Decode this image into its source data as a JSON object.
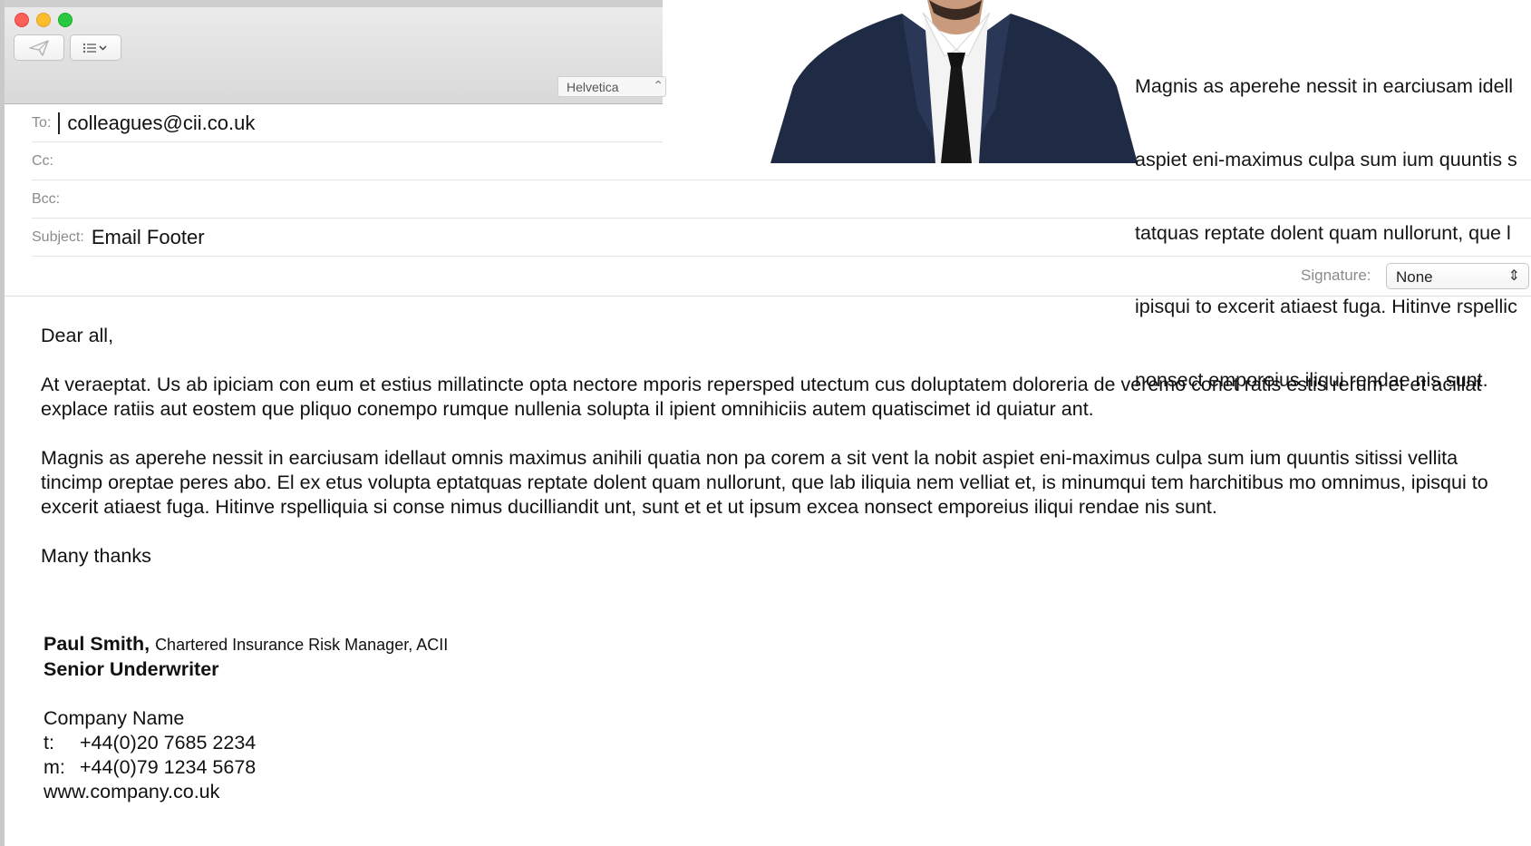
{
  "background_doc": {
    "paragraph_lines": [
      "Magnis as aperehe nessit in earciusam idell",
      "aspiet eni-maximus culpa sum ium quuntis s",
      "tatquas reptate dolent quam nullorunt, que l",
      "ipisqui to excerit atiaest fuga. Hitinve rspellic",
      "nonsect emporeius iliqui rendae nis sunt."
    ]
  },
  "toolbar": {
    "send_icon": "paper-plane-icon",
    "format_icon": "list-icon",
    "font_select": "Helvetica"
  },
  "header": {
    "to_label": "To:",
    "to_value": "colleagues@cii.co.uk",
    "cc_label": "Cc:",
    "cc_value": "",
    "bcc_label": "Bcc:",
    "bcc_value": "",
    "subject_label": "Subject:",
    "subject_value": "Email Footer",
    "signature_label": "Signature:",
    "signature_value": "None"
  },
  "body": {
    "greeting": "Dear all,",
    "paragraph1": "At veraeptat. Us ab ipiciam con eum et estius millatincte opta nectore mporis repersped utectum cus doluptatem doloreria de veremo conet ratis estis rerum et et acillat explace ratiis aut eostem que pliquo conempo rumque nullenia solupta il ipient omnihiciis autem quatiscimet id quiatur ant.",
    "paragraph2": "Magnis as aperehe nessit in earciusam idellaut omnis maximus anihili quatia non pa corem a sit vent la nobit aspiet eni-maximus culpa sum ium quuntis sitissi vellita tincimp oreptae peres abo. El ex etus volupta eptatquas reptate dolent quam nullorunt, que lab iliquia nem velliat et, is minumqui tem harchitibus mo omnimus, ipisqui to excerit atiaest fuga. Hitinve rspelliquia si conse nimus ducilliandit unt, sunt et et ut ipsum excea nonsect emporeius iliqui rendae nis sunt.",
    "closing": "Many thanks"
  },
  "signature": {
    "name": "Paul Smith,",
    "credentials": "Chartered Insurance Risk Manager, ACII",
    "title": "Senior Underwriter",
    "company": "Company Name",
    "phone_label": "t:",
    "phone": "+44(0)20 7685 2234",
    "mobile_label": "m:",
    "mobile": "+44(0)79 1234 5678",
    "website": "www.company.co.uk"
  }
}
